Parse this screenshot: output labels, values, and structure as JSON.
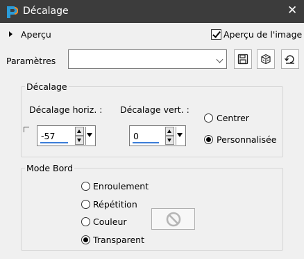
{
  "window": {
    "title": "Décalage",
    "close_label": "✕"
  },
  "preview": {
    "toggle_label": "Aperçu",
    "checkbox_label": "Aperçu de l'image",
    "checked": true
  },
  "params": {
    "label": "Paramètres",
    "preset_value": ""
  },
  "toolbar": {
    "icons": [
      "save-icon",
      "random-icon",
      "reset-icon"
    ]
  },
  "offset": {
    "legend": "Décalage",
    "horiz": {
      "label": "Décalage horiz. :",
      "value": "-57"
    },
    "vert": {
      "label": "Décalage vert. :",
      "value": "0"
    },
    "modes": [
      {
        "label": "Centrer",
        "checked": false
      },
      {
        "label": "Personnalisée",
        "checked": true
      }
    ]
  },
  "edge_mode": {
    "legend": "Mode Bord",
    "options": [
      {
        "label": "Enroulement",
        "checked": false
      },
      {
        "label": "Répétition",
        "checked": false
      },
      {
        "label": "Couleur",
        "checked": false
      },
      {
        "label": "Transparent",
        "checked": true
      }
    ],
    "swatch_icon": "disabled-icon"
  },
  "colors": {
    "titlebar": "#3c3c3c",
    "accent": "#3b7dd8",
    "background": "#f0f0f0"
  }
}
